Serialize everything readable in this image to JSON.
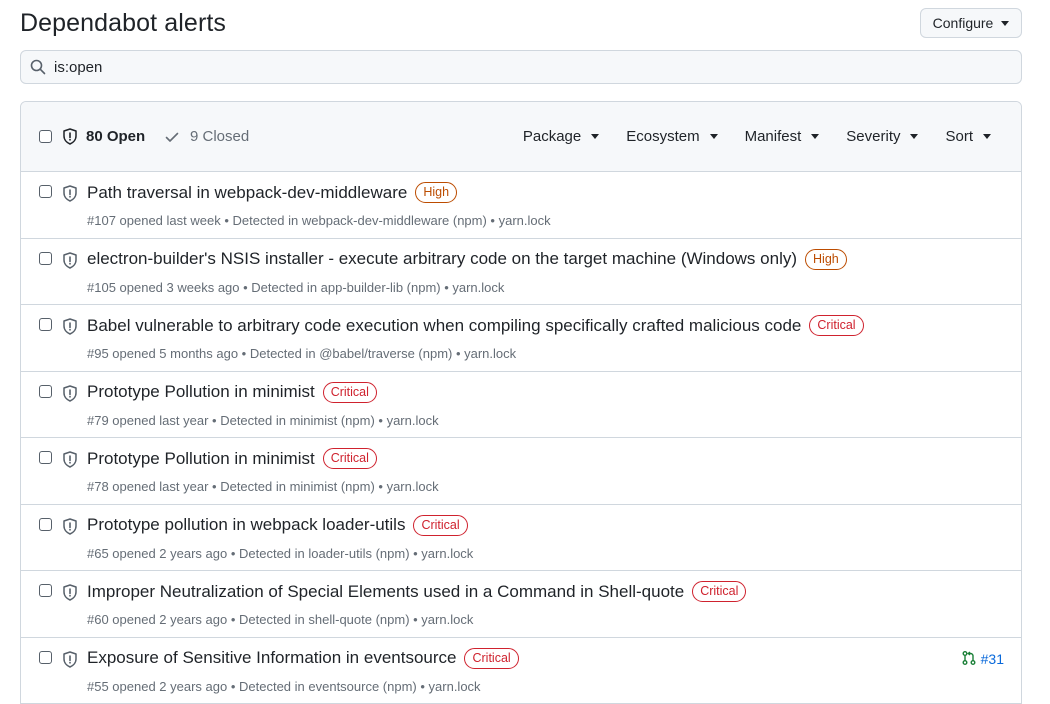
{
  "page": {
    "title": "Dependabot alerts"
  },
  "toolbar": {
    "configure_label": "Configure"
  },
  "search": {
    "value": "is:open"
  },
  "list_header": {
    "open_label": "80 Open",
    "closed_label": "9 Closed",
    "filters": [
      "Package",
      "Ecosystem",
      "Manifest",
      "Severity",
      "Sort"
    ]
  },
  "alerts": [
    {
      "title": "Path traversal in webpack-dev-middleware",
      "severity": "High",
      "meta": "#107 opened last week • Detected in webpack-dev-middleware (npm) • yarn.lock"
    },
    {
      "title": "electron-builder's NSIS installer - execute arbitrary code on the target machine (Windows only)",
      "severity": "High",
      "meta": "#105 opened 3 weeks ago • Detected in app-builder-lib (npm) • yarn.lock"
    },
    {
      "title": "Babel vulnerable to arbitrary code execution when compiling specifically crafted malicious code",
      "severity": "Critical",
      "meta": "#95 opened 5 months ago • Detected in @babel/traverse (npm) • yarn.lock"
    },
    {
      "title": "Prototype Pollution in minimist",
      "severity": "Critical",
      "meta": "#79 opened last year • Detected in minimist (npm) • yarn.lock"
    },
    {
      "title": "Prototype Pollution in minimist",
      "severity": "Critical",
      "meta": "#78 opened last year • Detected in minimist (npm) • yarn.lock"
    },
    {
      "title": "Prototype pollution in webpack loader-utils",
      "severity": "Critical",
      "meta": "#65 opened 2 years ago • Detected in loader-utils (npm) • yarn.lock"
    },
    {
      "title": "Improper Neutralization of Special Elements used in a Command in Shell-quote",
      "severity": "Critical",
      "meta": "#60 opened 2 years ago • Detected in shell-quote (npm) • yarn.lock"
    },
    {
      "title": "Exposure of Sensitive Information in eventsource",
      "severity": "Critical",
      "meta": "#55 opened 2 years ago • Detected in eventsource (npm) • yarn.lock",
      "pr": "#31"
    }
  ],
  "colors": {
    "high": "#bc4c00",
    "critical": "#cf222e",
    "link": "#0969da",
    "pr_icon": "#1a7f37"
  },
  "icons": {
    "search": "search-icon",
    "shield": "shield-alert-icon",
    "check": "check-icon",
    "caret": "caret-down-icon",
    "pr": "pull-request-icon"
  }
}
